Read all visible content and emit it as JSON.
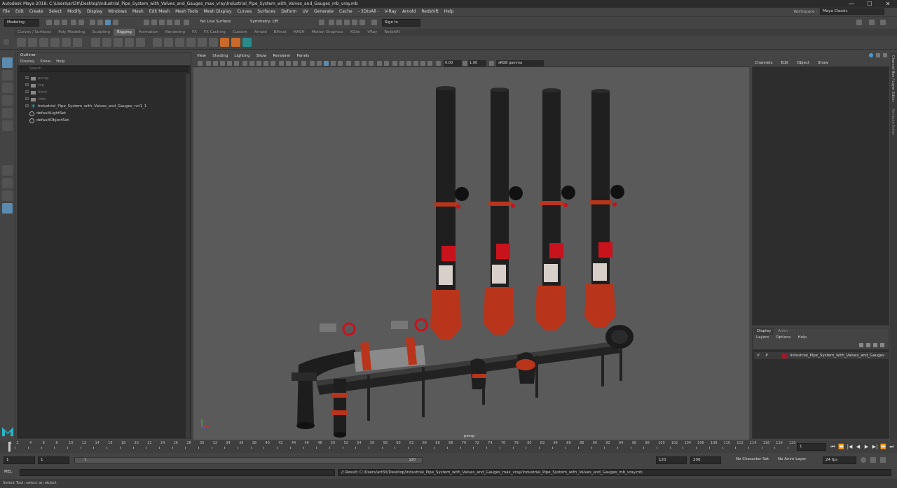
{
  "window": {
    "title": "Autodesk Maya 2018: C:\\Users\\art30\\Desktop\\Industrial_Pipe_System_with_Valves_and_Gauges_max_vray\\Industrial_Pipe_System_with_Valves_and_Gauges_mb_vray.mb",
    "minimize": "—",
    "maximize": "☐",
    "close": "✕"
  },
  "menubar": {
    "items": [
      "File",
      "Edit",
      "Create",
      "Select",
      "Modify",
      "Display",
      "Windows",
      "Mesh",
      "Edit Mesh",
      "Mesh Tools",
      "Mesh Display",
      "Curves",
      "Surfaces",
      "Deform",
      "UV",
      "Generate",
      "Cache",
      "- 3DtoAll -",
      "V-Ray",
      "Arnold",
      "Redshift",
      "Help"
    ],
    "workspace_label": "Workspace :",
    "workspace_value": "Maya Classic"
  },
  "statusline": {
    "mode": "Modeling",
    "live_surface": "No Live Surface",
    "symmetry": "Symmetry: Off",
    "sign_in": "Sign In"
  },
  "shelf": {
    "tabs": [
      "Curves / Surfaces",
      "Poly Modeling",
      "Sculpting",
      "Rigging",
      "Animation",
      "Rendering",
      "FX",
      "FX Caching",
      "Custom",
      "Arnold",
      "Bifrost",
      "MASH",
      "Motion Graphics",
      "XGen",
      "VRay",
      "Redshift"
    ],
    "active_tab": "Rigging"
  },
  "outliner": {
    "title": "Outliner",
    "menu": [
      "Display",
      "Show",
      "Help"
    ],
    "search_placeholder": "Search...",
    "nodes": [
      {
        "label": "persp",
        "dim": true
      },
      {
        "label": "top",
        "dim": true
      },
      {
        "label": "front",
        "dim": true
      },
      {
        "label": "side",
        "dim": true
      },
      {
        "label": "Industrial_Pipe_System_with_Valves_and_Gauges_ncl1_1",
        "dim": false
      },
      {
        "label": "defaultLightSet",
        "dim": false
      },
      {
        "label": "defaultObjectSet",
        "dim": false
      }
    ]
  },
  "viewport": {
    "menu": [
      "View",
      "Shading",
      "Lighting",
      "Show",
      "Renderer",
      "Panels"
    ],
    "exposure": "0.00",
    "gamma": "1.00",
    "color_space": "sRGB gamma",
    "camera": "persp"
  },
  "channelbox": {
    "menu": [
      "Channels",
      "Edit",
      "Object",
      "Show"
    ],
    "side_tabs": [
      "Channel Box / Layer Editor",
      "Attribute Editor"
    ]
  },
  "layer_editor": {
    "tabs": [
      "Display",
      "Anim"
    ],
    "menu": [
      "Layers",
      "Options",
      "Help"
    ],
    "layer": {
      "v": "V",
      "p": "P",
      "name": "Industrial_Pipe_System_with_Valves_and_Gauges",
      "color": "#9e1b2c"
    }
  },
  "timeline": {
    "tick_labels": [
      "1",
      "2",
      "4",
      "6",
      "8",
      "10",
      "12",
      "14",
      "16",
      "18",
      "20",
      "22",
      "24",
      "26",
      "28",
      "30",
      "32",
      "34",
      "36",
      "38",
      "40",
      "42",
      "44",
      "46",
      "48",
      "50",
      "52",
      "54",
      "56",
      "58",
      "60",
      "62",
      "64",
      "66",
      "68",
      "70",
      "72",
      "74",
      "76",
      "78",
      "80",
      "82",
      "84",
      "86",
      "88",
      "90",
      "92",
      "94",
      "96",
      "98",
      "100",
      "102",
      "104",
      "106",
      "108",
      "110",
      "112",
      "114",
      "116",
      "118",
      "120"
    ],
    "current_frame": "1",
    "play_controls": [
      "⏮",
      "⏪",
      "|◀",
      "◀",
      "▶",
      "▶|",
      "⏩",
      "⏭"
    ]
  },
  "range": {
    "start": "1",
    "start_inner": "1",
    "bar_start": "1",
    "bar_end": "120",
    "end_inner": "120",
    "end": "200",
    "character_set": "No Character Set",
    "anim_layer": "No Anim Layer",
    "fps": "24 fps"
  },
  "command": {
    "mel_label": "MEL",
    "result": "// Result: C:/Users/art30/Desktop/Industrial_Pipe_System_with_Valves_and_Gauges_max_vray/Industrial_Pipe_System_with_Valves_and_Gauges_mb_vray.mb"
  },
  "helpline": {
    "text": "Select Tool: select an object"
  },
  "colors": {
    "accent": "#5a8ab0",
    "pipe_dark": "#1f1f1f",
    "pipe_orange": "#b8351c",
    "valve_red": "#c8121c"
  }
}
